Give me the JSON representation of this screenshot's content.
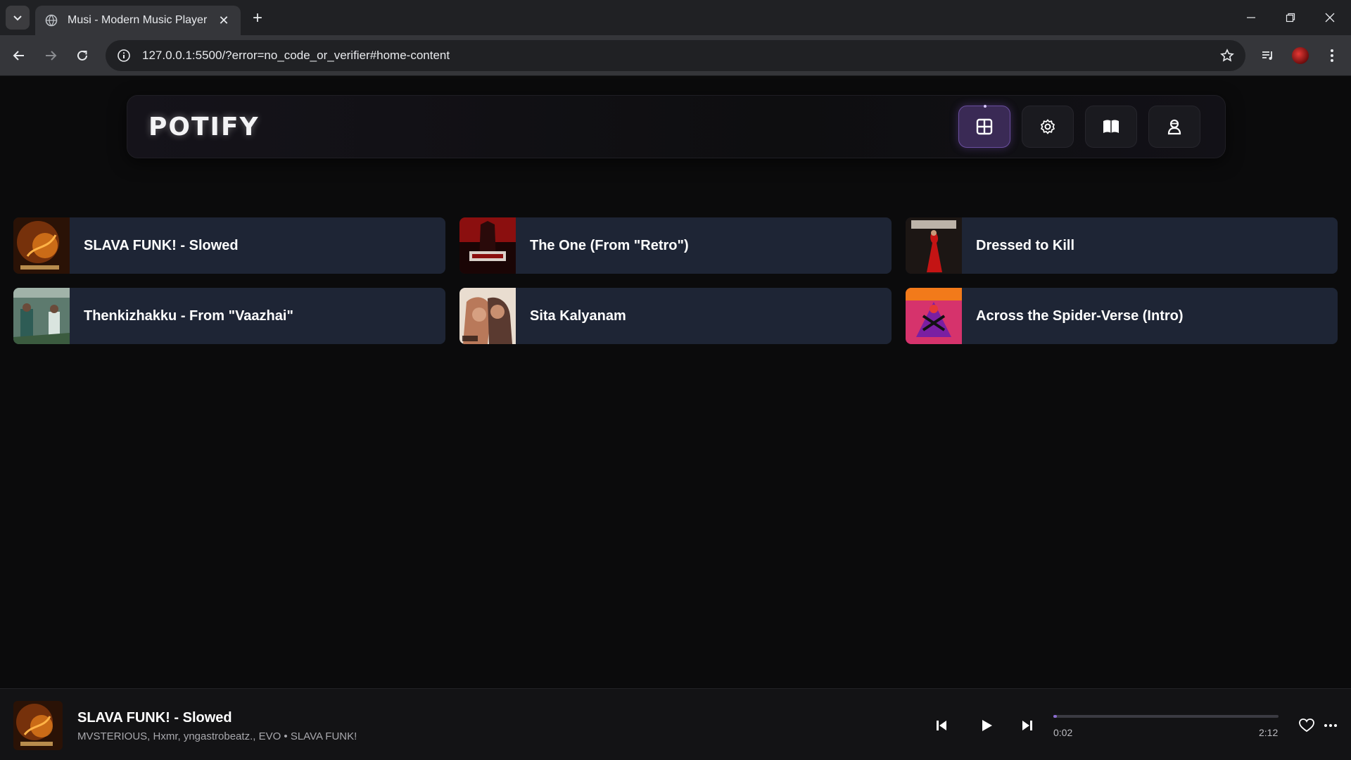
{
  "browser": {
    "tab_title": "Musi - Modern Music Player",
    "url": "127.0.0.1:5500/?error=no_code_or_verifier#home-content"
  },
  "app": {
    "logo": "POTIFY",
    "nav": [
      {
        "name": "grid-icon",
        "active": true
      },
      {
        "name": "settings-icon",
        "active": false
      },
      {
        "name": "book-icon",
        "active": false
      },
      {
        "name": "user-icon",
        "active": false
      }
    ]
  },
  "tracks": [
    {
      "title": "SLAVA FUNK! - Slowed"
    },
    {
      "title": "The One (From \"Retro\")"
    },
    {
      "title": "Dressed to Kill"
    },
    {
      "title": "Thenkizhakku - From \"Vaazhai\""
    },
    {
      "title": "Sita Kalyanam"
    },
    {
      "title": "Across the Spider-Verse (Intro)"
    }
  ],
  "player": {
    "title": "SLAVA FUNK! - Slowed",
    "artist_line": "MVSTERIOUS, Hxmr, yngastrobeatz., EVO • SLAVA FUNK!",
    "current_time": "0:02",
    "duration": "2:12",
    "progress_fraction": 0.015
  },
  "colors": {
    "accent": "#8a6ccf",
    "card_bg": "#1e2535",
    "page_bg": "#0b0b0c"
  }
}
